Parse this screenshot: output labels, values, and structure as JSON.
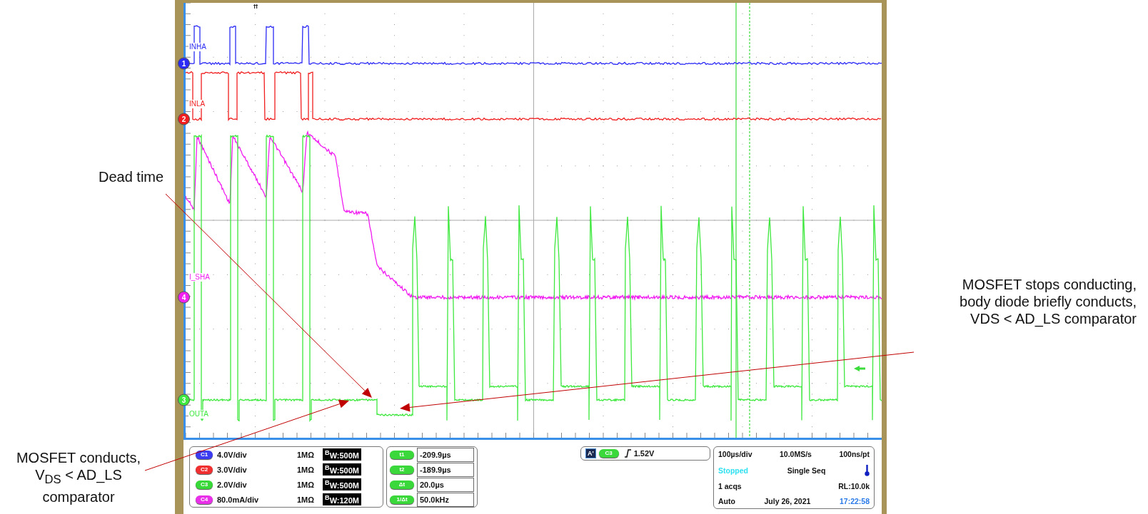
{
  "annotations": {
    "dead_time": "Dead time",
    "body_diode": "MOSFET stops conducting,\nbody diode briefly conducts,\nVDS < AD_LS comparator",
    "conducts": "MOSFET conducts,\nV$_{DS}$ < AD_LS\ncomparator"
  },
  "traces": [
    {
      "number": "1",
      "label": "INHA",
      "color": "#2b2bf5",
      "kind": "input-high"
    },
    {
      "number": "2",
      "label": "INLA",
      "color": "#f01e1e",
      "kind": "input-low"
    },
    {
      "number": "4",
      "label": "I_SHA",
      "color": "#f01ef0",
      "kind": "current"
    },
    {
      "number": "3",
      "label": "OUTA",
      "color": "#3ee83e",
      "kind": "output"
    }
  ],
  "channels": [
    {
      "badge": "C1",
      "scale": "4.0V/div",
      "impedance": "1MΩ",
      "bandwidth": "$^{B}$W:500M",
      "color": "#3c3cf0"
    },
    {
      "badge": "C2",
      "scale": "3.0V/div",
      "impedance": "1MΩ",
      "bandwidth": "$^{B}$W:500M",
      "color": "#f03030"
    },
    {
      "badge": "C3",
      "scale": "2.0V/div",
      "impedance": "1MΩ",
      "bandwidth": "$^{B}$W:500M",
      "color": "#38d838"
    },
    {
      "badge": "C4",
      "scale": "80.0mA/div",
      "impedance": "1MΩ",
      "bandwidth": "$^{B}$W:120M",
      "color": "#e830e8"
    }
  ],
  "cursors": [
    {
      "badge": "t1",
      "value": "-209.9µs"
    },
    {
      "badge": "t2",
      "value": "-189.9µs"
    },
    {
      "badge": "Δt",
      "value": "20.0µs"
    },
    {
      "badge": "1/Δt",
      "value": "50.0kHz"
    }
  ],
  "trigger": {
    "mode": "A'",
    "channel": "C3",
    "level": "1.52V"
  },
  "timebase": {
    "scale": "100µs/div",
    "sample_rate": "10.0MS/s",
    "resolution": "100ns/pt",
    "state": "Stopped",
    "acquisition": "Single Seq",
    "acqs": "1 acqs",
    "record_length": "RL:10.0k",
    "trigger_mode": "Auto",
    "date": "July 26, 2021",
    "time": "17:22:58"
  }
}
